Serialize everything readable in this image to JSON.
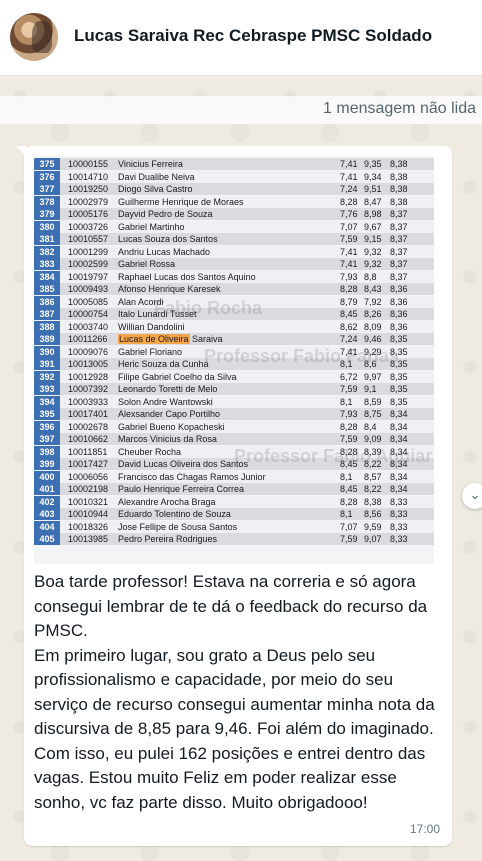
{
  "header": {
    "title": "Lucas Saraiva Rec Cebraspe PMSC Soldado"
  },
  "unread_banner": "1 mensagem não lida",
  "table_rows": [
    {
      "pos": "375",
      "id": "10000155",
      "name": "Vinicius Ferreira",
      "a": "7,41",
      "b": "9,35",
      "c": "8,38"
    },
    {
      "pos": "376",
      "id": "10014710",
      "name": "Davi Dualibe Neiva",
      "a": "7,41",
      "b": "9,34",
      "c": "8,38"
    },
    {
      "pos": "377",
      "id": "10019250",
      "name": "Diogo  Silva Castro",
      "a": "7,24",
      "b": "9,51",
      "c": "8,38"
    },
    {
      "pos": "378",
      "id": "10002979",
      "name": "Guilherme Henrique de Moraes",
      "a": "8,28",
      "b": "8,47",
      "c": "8,38"
    },
    {
      "pos": "379",
      "id": "10005176",
      "name": "Dayvid  Pedro de Souza",
      "a": "7,76",
      "b": "8,98",
      "c": "8,37"
    },
    {
      "pos": "380",
      "id": "10003726",
      "name": "Gabriel Martinho",
      "a": "7,07",
      "b": "9,67",
      "c": "8,37"
    },
    {
      "pos": "381",
      "id": "10010557",
      "name": "Lucas Souza dos Santos",
      "a": "7,59",
      "b": "9,15",
      "c": "8,37"
    },
    {
      "pos": "382",
      "id": "10001299",
      "name": "Andriu Lucas Machado",
      "a": "7,41",
      "b": "9,32",
      "c": "8,37"
    },
    {
      "pos": "383",
      "id": "10002599",
      "name": "Gabriel Rossa",
      "a": "7,41",
      "b": "9,32",
      "c": "8,37"
    },
    {
      "pos": "384",
      "id": "10019797",
      "name": "Raphael Lucas dos Santos Aquino",
      "a": "7,93",
      "b": "8,8",
      "c": "8,37"
    },
    {
      "pos": "385",
      "id": "10009493",
      "name": "Afonso Henrique Karesek",
      "a": "8,28",
      "b": "8,43",
      "c": "8,36"
    },
    {
      "pos": "386",
      "id": "10005085",
      "name": "Alan Acordi",
      "a": "8,79",
      "b": "7,92",
      "c": "8,36"
    },
    {
      "pos": "387",
      "id": "10000754",
      "name": "Italo Lunardi Tusset",
      "a": "8,45",
      "b": "8,26",
      "c": "8,36"
    },
    {
      "pos": "388",
      "id": "10003740",
      "name": "Willian Dandolini",
      "a": "8,62",
      "b": "8,09",
      "c": "8,36"
    },
    {
      "pos": "389",
      "id": "10011266",
      "name": "Lucas de  Oliveira",
      "name_rest": " Saraiva",
      "a": "7,24",
      "b": "9,46",
      "c": "8,35"
    },
    {
      "pos": "390",
      "id": "10009076",
      "name": "Gabriel Floriano",
      "a": "7,41",
      "b": "9,29",
      "c": "8,35"
    },
    {
      "pos": "391",
      "id": "10013005",
      "name": "Heric Souza da Cunha",
      "a": "8,1",
      "b": "8,6",
      "c": "8,35"
    },
    {
      "pos": "392",
      "id": "10012928",
      "name": "Filipe Gabriel Coelho da Silva",
      "a": "6,72",
      "b": "9,97",
      "c": "8,35"
    },
    {
      "pos": "393",
      "id": "10007392",
      "name": "Leonardo Toretti de Melo",
      "a": "7,59",
      "b": "9,1",
      "c": "8,35"
    },
    {
      "pos": "394",
      "id": "10003933",
      "name": "Solon Andre Wantowski",
      "a": "8,1",
      "b": "8,59",
      "c": "8,35"
    },
    {
      "pos": "395",
      "id": "10017401",
      "name": "Alexsander Capo Portilho",
      "a": "7,93",
      "b": "8,75",
      "c": "8,34"
    },
    {
      "pos": "396",
      "id": "10002678",
      "name": "Gabriel Bueno Kopacheski",
      "a": "8,28",
      "b": "8,4",
      "c": "8,34"
    },
    {
      "pos": "397",
      "id": "10010662",
      "name": "Marcos Vinicius da Rosa",
      "a": "7,59",
      "b": "9,09",
      "c": "8,34"
    },
    {
      "pos": "398",
      "id": "10011851",
      "name": "Cheuber Rocha",
      "a": "8,28",
      "b": "8,39",
      "c": "8,34"
    },
    {
      "pos": "399",
      "id": "10017427",
      "name": "David Lucas Oliveira dos Santos",
      "a": "8,45",
      "b": "8,22",
      "c": "8,34"
    },
    {
      "pos": "400",
      "id": "10006056",
      "name": "Francisco das Chagas Ramos Junior",
      "a": "8,1",
      "b": "8,57",
      "c": "8,34"
    },
    {
      "pos": "401",
      "id": "10002198",
      "name": "Paulo Henrique Ferreira Correa",
      "a": "8,45",
      "b": "8,22",
      "c": "8,34"
    },
    {
      "pos": "402",
      "id": "10010321",
      "name": "Alexandre Arocha Braga",
      "a": "8,28",
      "b": "8,38",
      "c": "8,33"
    },
    {
      "pos": "403",
      "id": "10010944",
      "name": "Eduardo Tolentino de Souza",
      "a": "8,1",
      "b": "8,56",
      "c": "8,33"
    },
    {
      "pos": "404",
      "id": "10018326",
      "name": "Jose Fellipe de Sousa Santos",
      "a": "7,07",
      "b": "9,59",
      "c": "8,33"
    },
    {
      "pos": "405",
      "id": "10013985",
      "name": "Pedro Pereira Rodrigues",
      "a": "7,59",
      "b": "9,07",
      "c": "8,33"
    }
  ],
  "watermarks": [
    "Fabio Rocha",
    "Professor Fabio Farias",
    "Professor Fabio Aguiar"
  ],
  "message": {
    "text": "Boa tarde professor! Estava na correria e só agora consegui lembrar de te dá o feedback do recurso da PMSC.\nEm primeiro lugar, sou grato a Deus pelo seu profissionalismo e capacidade, por meio do seu serviço de recurso consegui aumentar minha nota da discursiva de 8,85 para 9,46. Foi além do imaginado. Com isso, eu pulei 162 posições e entrei dentro das vagas. Estou muito Feliz em poder realizar esse sonho, vc faz parte disso. Muito obrigadooo!",
    "time": "17:00"
  },
  "icons": {
    "scroll": "chevron-down-icon"
  },
  "colors": {
    "chat_background": "#efeae2",
    "position_column": "#3d6fb3",
    "highlight": "#f5a54a"
  }
}
